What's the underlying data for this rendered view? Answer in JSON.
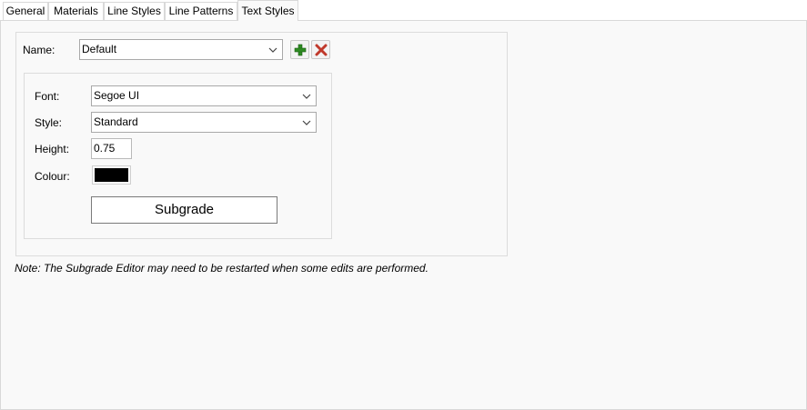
{
  "tabs": [
    {
      "label": "General"
    },
    {
      "label": "Materials"
    },
    {
      "label": "Line Styles"
    },
    {
      "label": "Line Patterns"
    },
    {
      "label": "Text Styles",
      "active": true
    }
  ],
  "name_field": {
    "label": "Name:",
    "value": "Default"
  },
  "buttons": {
    "add_icon": "plus-icon",
    "remove_icon": "delete-x-icon"
  },
  "font_field": {
    "label": "Font:",
    "value": "Segoe UI"
  },
  "style_field": {
    "label": "Style:",
    "value": "Standard"
  },
  "height_field": {
    "label": "Height:",
    "value": "0.75"
  },
  "colour_field": {
    "label": "Colour:",
    "color": "#000000"
  },
  "preview": {
    "text": "Subgrade"
  },
  "note": "Note: The Subgrade Editor may need to be restarted when some edits are performed.",
  "colors": {
    "add_icon": "#2e8b22",
    "remove_icon": "#c0392b"
  }
}
